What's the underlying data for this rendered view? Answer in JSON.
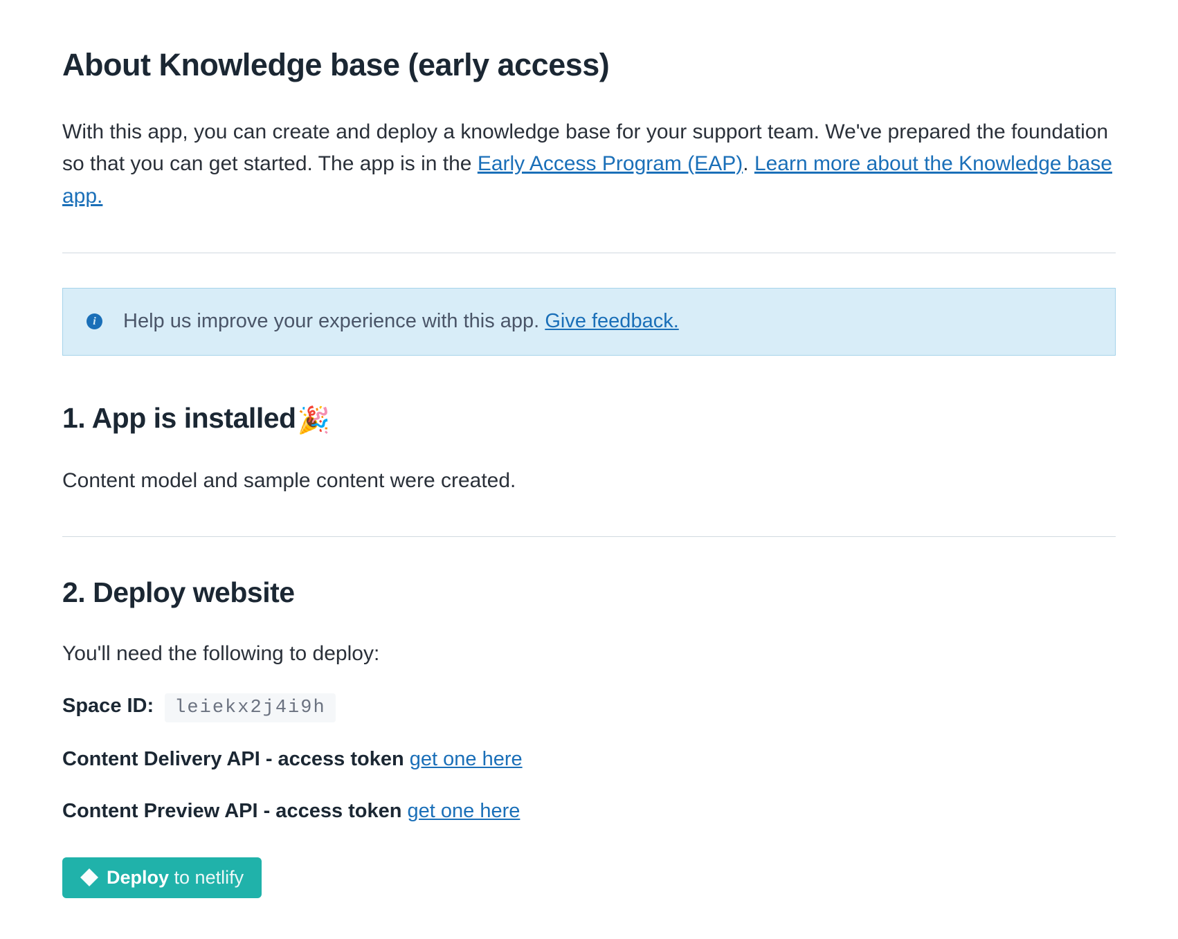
{
  "header": {
    "title": "About Knowledge base (early access)",
    "intro_part1": "With this app, you can create and deploy a knowledge base for your support team. We've prepared the foundation so that you can get started. The app is in the ",
    "eap_link": "Early Access Program (EAP)",
    "intro_sep": ". ",
    "learn_more_link": "Learn more about the Knowledge base app."
  },
  "banner": {
    "text_prefix": "Help us improve your experience with this app. ",
    "feedback_link": "Give feedback."
  },
  "step1": {
    "heading": "1. App is installed",
    "emoji": "🎉",
    "text": "Content model and sample content were created."
  },
  "step2": {
    "heading": "2. Deploy website",
    "intro": "You'll need the following to deploy:",
    "space_id_label": "Space ID:",
    "space_id_value": "leiekx2j4i9h",
    "delivery_label": "Content Delivery API - access token ",
    "delivery_link": "get one here",
    "preview_label": "Content Preview API - access token ",
    "preview_link": "get one here",
    "deploy_bold": "Deploy",
    "deploy_light": " to netlify"
  }
}
